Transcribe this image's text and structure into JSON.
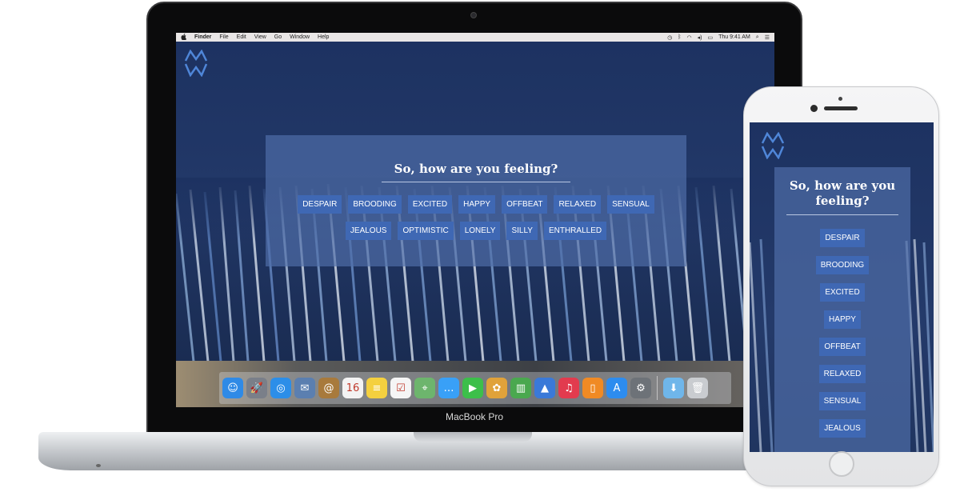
{
  "menubar": {
    "apple": "",
    "items": [
      "Finder",
      "File",
      "Edit",
      "View",
      "Go",
      "Window",
      "Help"
    ],
    "clock": "Thu 9:41 AM"
  },
  "site": {
    "question": "So, how are you feeling?",
    "moods": [
      "DESPAIR",
      "BROODING",
      "EXCITED",
      "HAPPY",
      "OFFBEAT",
      "RELAXED",
      "SENSUAL",
      "JEALOUS",
      "OPTIMISTIC",
      "LONELY",
      "SILLY",
      "ENTHRALLED"
    ]
  },
  "mobile": {
    "question": "So, how are you feeling?",
    "moods": [
      "DESPAIR",
      "BROODING",
      "EXCITED",
      "HAPPY",
      "OFFBEAT",
      "RELAXED",
      "SENSUAL",
      "JEALOUS"
    ]
  },
  "dock": {
    "calendar_day": "16",
    "apps": [
      {
        "name": "finder-icon",
        "glyph": "☺",
        "color": "#2f8ae6"
      },
      {
        "name": "launchpad-icon",
        "glyph": "🚀",
        "color": "#7a7f89"
      },
      {
        "name": "safari-icon",
        "glyph": "◎",
        "color": "#2c8ee8"
      },
      {
        "name": "mail-icon",
        "glyph": "✉",
        "color": "#5b7fb0"
      },
      {
        "name": "contacts-icon",
        "glyph": "@",
        "color": "#a87a3c"
      },
      {
        "name": "calendar-icon",
        "glyph": "16",
        "color": "#f3f3f3"
      },
      {
        "name": "notes-icon",
        "glyph": "≡",
        "color": "#f4d03f"
      },
      {
        "name": "reminders-icon",
        "glyph": "☑",
        "color": "#f5f5f5"
      },
      {
        "name": "maps-icon",
        "glyph": "⌖",
        "color": "#6db56d"
      },
      {
        "name": "messages-icon",
        "glyph": "…",
        "color": "#39a0f7"
      },
      {
        "name": "facetime-icon",
        "glyph": "▶",
        "color": "#3cbf4a"
      },
      {
        "name": "photos-icon",
        "glyph": "✿",
        "color": "#e0a23a"
      },
      {
        "name": "numbers-icon",
        "glyph": "▥",
        "color": "#4aa84f"
      },
      {
        "name": "keynote-icon",
        "glyph": "▲",
        "color": "#3a79d8"
      },
      {
        "name": "itunes-icon",
        "glyph": "♫",
        "color": "#e23b4e"
      },
      {
        "name": "ibooks-icon",
        "glyph": "▯",
        "color": "#f08a24"
      },
      {
        "name": "app-store-icon",
        "glyph": "A",
        "color": "#2d8cef"
      },
      {
        "name": "system-preferences-icon",
        "glyph": "⚙",
        "color": "#6d7278"
      }
    ],
    "trailing": [
      {
        "name": "downloads-folder-icon",
        "glyph": "⬇",
        "color": "#6fb6ea"
      },
      {
        "name": "trash-icon",
        "glyph": "🗑",
        "color": "#c9ccd0"
      }
    ]
  },
  "device": {
    "laptop_label": "MacBook Pro"
  },
  "colors": {
    "accent": "#3f68b4",
    "panel": "#4f6eaa",
    "background": "#1d3261"
  }
}
